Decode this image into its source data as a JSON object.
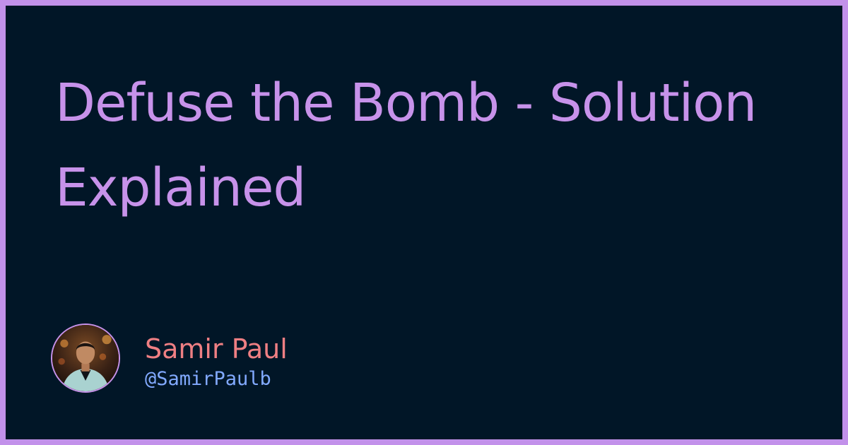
{
  "card": {
    "title": "Defuse the Bomb - Solution Explained"
  },
  "author": {
    "name": "Samir Paul",
    "handle": "@SamirPaulb",
    "avatar_icon": "author-photo-avatar"
  },
  "colors": {
    "border": "#c291ea",
    "background": "#011627",
    "title": "#c792ea",
    "name": "#ef7f83",
    "handle": "#82aaff"
  }
}
